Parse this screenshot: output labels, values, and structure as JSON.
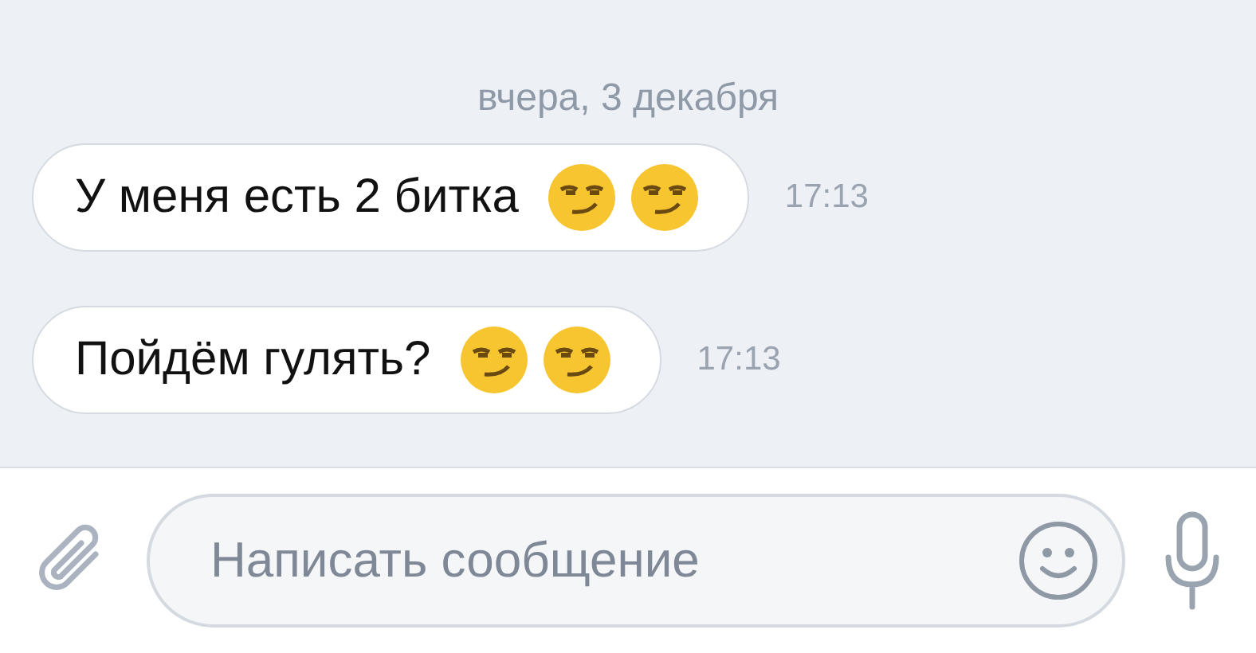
{
  "date_divider": "вчера, 3 декабря",
  "messages": [
    {
      "text": "У меня есть 2 битка",
      "time": "17:13"
    },
    {
      "text": "Пойдём гулять?",
      "time": "17:13"
    }
  ],
  "composer": {
    "placeholder": "Написать сообщение"
  }
}
